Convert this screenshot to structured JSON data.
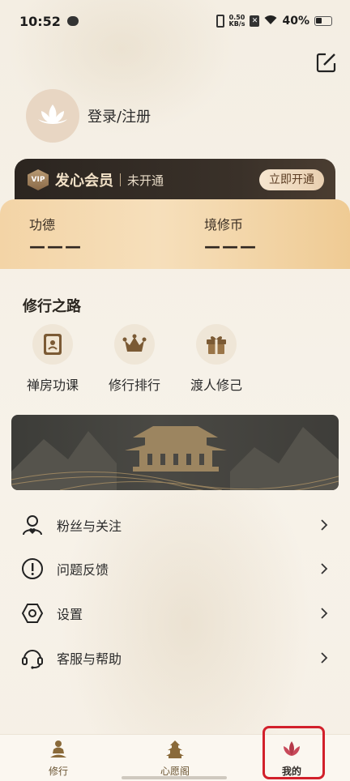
{
  "status_bar": {
    "time": "10:52",
    "speed_top": "0.50",
    "speed_bottom": "KB/s",
    "battery": "40%"
  },
  "profile": {
    "login_label": "登录/注册"
  },
  "vip": {
    "badge": "VIP",
    "title": "发心会员",
    "status": "未开通",
    "open_button": "立即开通"
  },
  "merits": [
    {
      "label": "功德",
      "value": "———"
    },
    {
      "label": "境修币",
      "value": "———"
    }
  ],
  "practice": {
    "title": "修行之路",
    "shortcuts": [
      {
        "label": "禅房功课",
        "icon": "book-icon"
      },
      {
        "label": "修行排行",
        "icon": "crown-icon"
      },
      {
        "label": "渡人修己",
        "icon": "gift-icon"
      }
    ]
  },
  "menu": [
    {
      "label": "粉丝与关注",
      "icon": "user-heart-icon"
    },
    {
      "label": "问题反馈",
      "icon": "exclamation-icon"
    },
    {
      "label": "设置",
      "icon": "hex-settings-icon"
    },
    {
      "label": "客服与帮助",
      "icon": "headset-icon"
    }
  ],
  "bottom_nav": [
    {
      "label": "修行",
      "icon": "meditation-icon"
    },
    {
      "label": "心愿阁",
      "icon": "pagoda-icon"
    },
    {
      "label": "我的",
      "icon": "lotus-icon",
      "active": true
    }
  ],
  "colors": {
    "accent": "#6a5432",
    "highlight": "#d2202b",
    "merit_gold": "#f3d4a6"
  }
}
